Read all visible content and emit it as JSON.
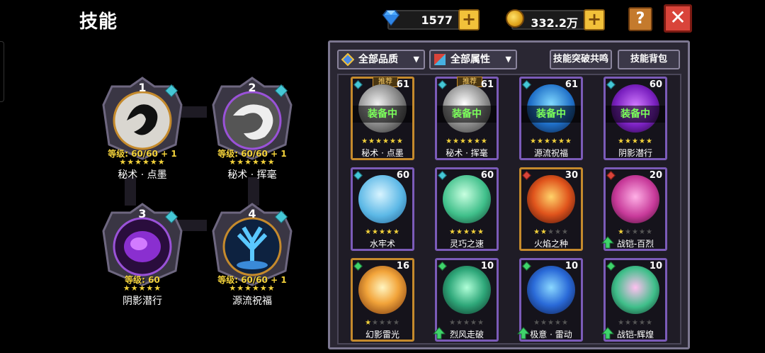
{
  "header": {
    "title": "技能"
  },
  "currencies": {
    "gems": "1577",
    "gold": "332.2万",
    "plus_label": "+"
  },
  "buttons": {
    "help": "?",
    "close": "✕"
  },
  "equipped": [
    {
      "num": "1",
      "level": "等级: 60/60 + 1",
      "stars": "★★★★★★",
      "name": "秘术 · 点墨"
    },
    {
      "num": "2",
      "level": "等级: 60/60 + 1",
      "stars": "★★★★★★",
      "name": "秘术 · 挥毫"
    },
    {
      "num": "3",
      "level": "等级: 60",
      "stars": "★★★★★",
      "name": "阴影潜行"
    },
    {
      "num": "4",
      "level": "等级: 60/60 + 1",
      "stars": "★★★★★★",
      "name": "源流祝福"
    }
  ],
  "panel": {
    "filter_quality": "全部品质",
    "filter_attr": "全部属性",
    "breakthrough": "技能突破共鸣",
    "bag": "技能背包"
  },
  "cards": [
    {
      "name": "秘术 · 点墨",
      "count": "61",
      "stars": "★★★★★★",
      "tag": "推荐",
      "equipped": "装备中"
    },
    {
      "name": "秘术 · 挥毫",
      "count": "61",
      "stars": "★★★★★★",
      "tag": "推荐",
      "equipped": "装备中"
    },
    {
      "name": "源流祝福",
      "count": "61",
      "stars": "★★★★★★",
      "equipped": "装备中"
    },
    {
      "name": "阴影潜行",
      "count": "60",
      "stars": "★★★★★",
      "equipped": "装备中"
    },
    {
      "name": "水牢术",
      "count": "60",
      "stars": "★★★★★"
    },
    {
      "name": "灵巧之速",
      "count": "60",
      "stars": "★★★★★"
    },
    {
      "name": "火焰之种",
      "count": "30",
      "stars_on": "★★",
      "stars_off": "★★★"
    },
    {
      "name": "战铠-百烈",
      "count": "20",
      "stars_on": "★",
      "stars_off": "★★★★"
    },
    {
      "name": "幻影雷光",
      "count": "16",
      "stars_on": "★",
      "stars_off": "★★★★"
    },
    {
      "name": "烈风走破",
      "count": "10",
      "stars_on": "",
      "stars_off": "★★★★★"
    },
    {
      "name": "极意 · 雷动",
      "count": "10",
      "stars_on": "",
      "stars_off": "★★★★★"
    },
    {
      "name": "战铠-辉煌",
      "count": "10",
      "stars_on": "",
      "stars_off": "★★★★★"
    }
  ],
  "icons": {
    "gem": "diamond-gem-icon",
    "coin": "gold-coin-icon",
    "upgrade": "green-up-arrow-icon"
  },
  "colors": {
    "accent_gold": "#f2c13a",
    "close_red": "#d9443a",
    "equipped_green": "#7bff5a",
    "star_yellow": "#f2d13a",
    "star_pink": "#ff7be0"
  }
}
